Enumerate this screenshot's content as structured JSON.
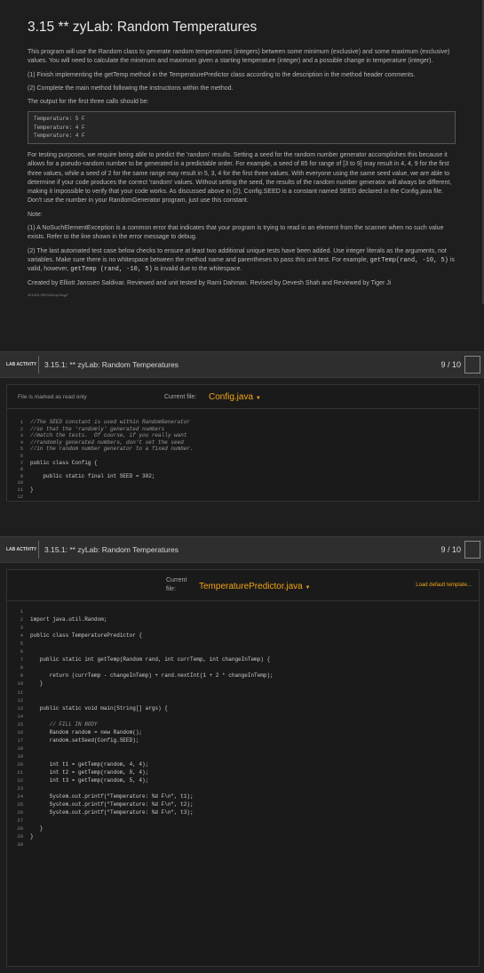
{
  "header": {
    "title": "3.15 ** zyLab: Random Temperatures",
    "p1": "This program will use the Random class to generate random temperatures (integers) between some minimum (exclusive) and some maximum (exclusive) values. You will need to calculate the minimum and maximum given a starting temperature (integer) and a possible change in temperature (integer).",
    "p2": "(1) Finish implementing the getTemp method in the TemperaturePredictor class according to the description in the method header comments.",
    "p3": "(2) Complete the main method following the instructions within the method.",
    "p4": "The output for the first three calls should be:",
    "output": [
      "Temperature: 5 F",
      "Temperature: 4 F",
      "Temperature: 4 F"
    ],
    "p5": "For testing purposes, we require being able to predict the 'random' results. Setting a seed for the random number generator accomplishes this because it allows for a pseudo-random number to be generated in a predictable order. For example, a seed of 85 for range of [3 to 9] may result in 4, 4, 9 for the first three values, while a seed of 2 for the same range may result in 5, 3, 4 for the first three values. With everyone using the same seed value, we are able to determine if your code produces the correct 'random' values. Without setting the seed, the results of the random number generator will always be different, making it impossible to verify that your code works. As discussed above in (2), Config.SEED is a constant named SEED declared in the Config.java file. Don't use the number in your RandomGenerator program, just use this constant.",
    "note_label": "Note:",
    "n1": "(1) A NoSuchElementException is a common error that indicates that your program is trying to read in an element from the scanner when no such value exists. Refer to the line shown in the error message to debug.",
    "n2a": "(2) The last automated test case below checks to ensure at least two additional unique tests have been added. Use integer literals as the arguments, not variables. Make sure there is no whitespace between the method name and parentheses to pass this unit test. For example,",
    "n2b": "getTemp(rand, -10, 5)",
    "n2c": " is valid, however, ",
    "n2d": "getTemp (rand, -10, 5)",
    "n2e": " is invalid due to the whitespace.",
    "credit": "Created by Elliott Janssen Saldivar. Reviewed and unit tested by Rami Dahman. Revised by Devesh Shah and Reviewed by Tiger Ji",
    "tiny": "421424.2927818.qx3zqy7"
  },
  "lab1": {
    "badge": "LAB ACTIVITY",
    "title": "3.15.1: ** zyLab: Random Temperatures",
    "score": "9 / 10"
  },
  "editor1": {
    "readonly": "File is marked as read only",
    "current_label": "Current file:",
    "file": "Config.java",
    "lines": [
      "//The SEED constant is used within RandomGenerator",
      "//so that the 'randomly' generated numbers",
      "//match the tests.  Of course, if you really want",
      "//randomly generated numbers, don't set the seed",
      "//in the random number generator to a fixed number.",
      "",
      "public class Config {",
      "",
      "    public static final int SEED = 302;",
      "",
      "}",
      ""
    ]
  },
  "lab2": {
    "badge": "LAB ACTIVITY",
    "title": "3.15.1: ** zyLab: Random Temperatures",
    "score": "9 / 10"
  },
  "editor2": {
    "current_label": "Current file:",
    "file": "TemperaturePredictor.java",
    "load_default": "Load default template...",
    "lines": [
      "",
      "import java.util.Random;",
      "",
      "public class TemperaturePredictor {",
      "",
      "",
      "   public static int getTemp(Random rand, int currTemp, int changeInTemp) {",
      "",
      "      return (currTemp - changeInTemp) + rand.nextInt(1 + 2 * changeInTemp);",
      "   }",
      "",
      "",
      "   public static void main(String[] args) {",
      "",
      "      // FILL IN BODY",
      "      Random random = new Random();",
      "      random.setSeed(Config.SEED);",
      "",
      "",
      "      int t1 = getTemp(random, 4, 4);",
      "      int t2 = getTemp(random, 8, 4);",
      "      int t3 = getTemp(random, 5, 4);",
      "",
      "      System.out.printf(\"Temperature: %d F\\n\", t1);",
      "      System.out.printf(\"Temperature: %d F\\n\", t2);",
      "      System.out.printf(\"Temperature: %d F\\n\", t3);",
      "",
      "   }",
      "}",
      ""
    ]
  },
  "colors": {
    "accent": "#f2a516",
    "background": "#1e1e1e"
  }
}
